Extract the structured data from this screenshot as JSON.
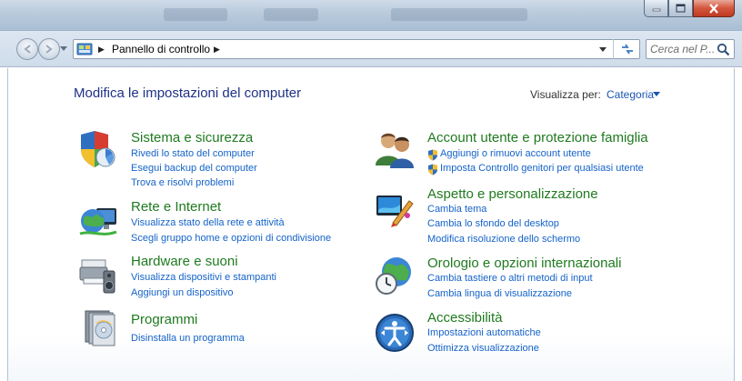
{
  "address": {
    "crumb": "Pannello di controllo"
  },
  "search": {
    "placeholder": "Cerca nel P..."
  },
  "header": {
    "title": "Modifica le impostazioni del computer",
    "view_by_label": "Visualizza per:",
    "view_by_value": "Categoria"
  },
  "categories": [
    {
      "title": "Sistema e sicurezza",
      "icon": "system-security-icon",
      "links": [
        "Rivedi lo stato del computer",
        "Esegui backup del computer",
        "Trova e risolvi problemi"
      ]
    },
    {
      "title": "Rete e Internet",
      "icon": "network-internet-icon",
      "links": [
        "Visualizza stato della rete e attività",
        "Scegli gruppo home e opzioni di condivisione"
      ]
    },
    {
      "title": "Hardware e suoni",
      "icon": "hardware-sound-icon",
      "links": [
        "Visualizza dispositivi e stampanti",
        "Aggiungi un dispositivo"
      ]
    },
    {
      "title": "Programmi",
      "icon": "programs-icon",
      "links": [
        "Disinstalla un programma"
      ]
    },
    {
      "title": "Account utente e protezione famiglia",
      "icon": "user-accounts-icon",
      "links": [
        "Aggiungi o rimuovi account utente",
        "Imposta Controllo genitori per qualsiasi utente"
      ]
    },
    {
      "title": "Aspetto e personalizzazione",
      "icon": "appearance-icon",
      "links": [
        "Cambia tema",
        "Cambia lo sfondo del desktop",
        "Modifica risoluzione dello schermo"
      ]
    },
    {
      "title": "Orologio e opzioni internazionali",
      "icon": "clock-region-icon",
      "links": [
        "Cambia tastiere o altri metodi di input",
        "Cambia lingua di visualizzazione"
      ]
    },
    {
      "title": "Accessibilità",
      "icon": "accessibility-icon",
      "links": [
        "Impostazioni automatiche",
        "Ottimizza visualizzazione"
      ]
    }
  ]
}
